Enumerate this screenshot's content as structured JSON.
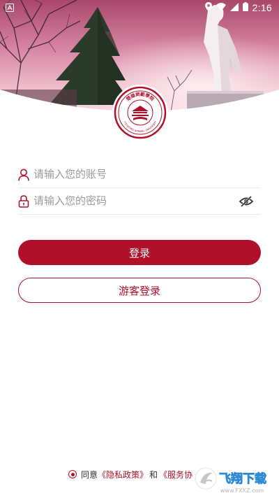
{
  "status_bar": {
    "time": "2:16",
    "left_icon": "a-icon",
    "icons": [
      "location-icon",
      "wifi-icon",
      "signal-icon",
      "battery-icon"
    ]
  },
  "header": {
    "logo_icon": "university-seal-icon",
    "logo_text_top": "楚雄師範學院",
    "logo_text_bottom": "CHUXIONG NORMAL UNIVERSITY"
  },
  "form": {
    "username_placeholder": "请输入您的账号",
    "password_placeholder": "请输入您的密码",
    "user_icon": "user-icon",
    "lock_icon": "lock-icon",
    "visibility_icon": "eye-off-icon"
  },
  "buttons": {
    "login_label": "登录",
    "guest_label": "游客登录"
  },
  "agreement": {
    "prefix": "同意",
    "privacy_link": "《隐私政策》",
    "conjunction": "和",
    "service_link": "《服务协"
  },
  "watermark": {
    "text": "飞翔下载",
    "url_text": "www.FXXZ.com"
  },
  "colors": {
    "accent": "#b0102a",
    "placeholder": "#9a9a9a",
    "divider": "#ececec"
  }
}
